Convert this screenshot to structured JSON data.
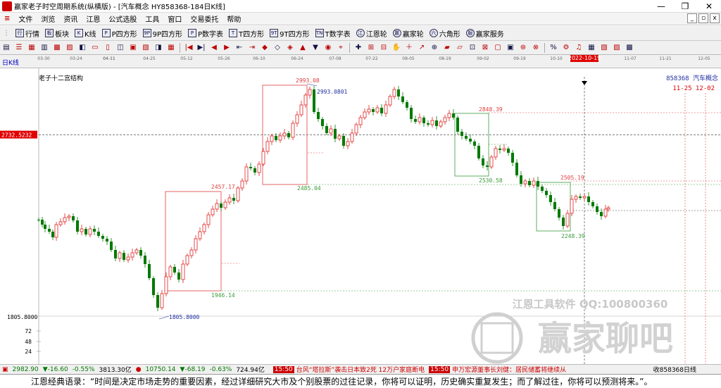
{
  "window": {
    "title": "赢家老子时空周期系统(纵横版) - [汽车概念  HY858368-184日K线]",
    "controls": [
      "—",
      "❐",
      "✕"
    ]
  },
  "menu": {
    "items": [
      "文件",
      "浏览",
      "资讯",
      "江恩",
      "公式选股",
      "工具",
      "窗口",
      "交易委托",
      "帮助"
    ]
  },
  "toolbar1": {
    "items": [
      {
        "icon": "行",
        "label": "行情"
      },
      {
        "icon": "板",
        "label": "板块"
      },
      {
        "icon": "K",
        "label": "K线"
      },
      {
        "icon": "P",
        "label": "P四方形"
      },
      {
        "icon": "9P",
        "label": "9P四方形"
      },
      {
        "icon": "P",
        "label": "P数字表"
      },
      {
        "icon": "T",
        "label": "T四方形"
      },
      {
        "icon": "9T",
        "label": "9T四方形"
      },
      {
        "icon": "TN",
        "label": "T数字表"
      },
      {
        "icon": "江",
        "label": "江恩轮"
      },
      {
        "icon": "赢",
        "label": "赢家轮"
      },
      {
        "icon": "六",
        "label": "六角形"
      },
      {
        "icon": "服",
        "label": "赢家服务"
      }
    ]
  },
  "chart": {
    "period_label": "日K线",
    "study_name": "老子十二宫结构",
    "code_label": "858368 汽车概念",
    "date_range": "11-25 12-02",
    "crosshair_price": "2732.5232",
    "crosshair_date": "2022-10-19",
    "bottom_price": "1805.8000",
    "volume_ticks": [
      "72",
      "48",
      "24"
    ],
    "date_ticks": [
      "03-30",
      "04-11",
      "03-24",
      "04-11",
      "04-25",
      "05-12",
      "05-26",
      "06-10",
      "06-24",
      "07-08",
      "07-22",
      "08-05",
      "08-19",
      "09-02",
      "09-19",
      "10-10",
      "2022-10-19",
      "11-07",
      "11-21",
      "12-05"
    ],
    "annotations": {
      "high_red": "2993.08",
      "high_blue": "2993.0801",
      "low1_green": "1946.14",
      "mid1_red": "2457.17",
      "low2_green": "2485.04",
      "box3_red": "2848.39",
      "box3_green": "2530.58",
      "box4_red": "2505.19",
      "box4_green": "2248.39",
      "low_blue": "1805.8000"
    },
    "watermark1": "江恩工具软件  QQ:100800360",
    "watermark2": "赢家聊吧",
    "colors": {
      "up": "#e02020",
      "down": "#007a00",
      "box_red": "#e04040",
      "box_green": "#3a9a3a"
    }
  },
  "statusbar": {
    "idx1_value": "2982.90",
    "idx1_change": "▼-16.60",
    "idx1_pct": "-0.55%",
    "idx1_amount": "3813.30亿",
    "idx2_value": "10750.14",
    "idx2_change": "▼-68.19",
    "idx2_pct": "-0.63%",
    "idx2_amount": "724.94亿",
    "news1_time": "15:50",
    "news1_text": "台风“塔拉斯”袭击日本致2死 12万户家庭断电",
    "news2_time": "15:50",
    "news2_text": "申万宏源董事长刘健：居民储蓄将继续从",
    "right_label": "收858368日线"
  },
  "quote": {
    "text": "江恩经典语录：“时间是决定市场走势的重要因素，经过详细研究大市及个别股票的过往记录，你将可以证明，历史确实重复发生；而了解过往，你将可以预测将来。”。"
  }
}
